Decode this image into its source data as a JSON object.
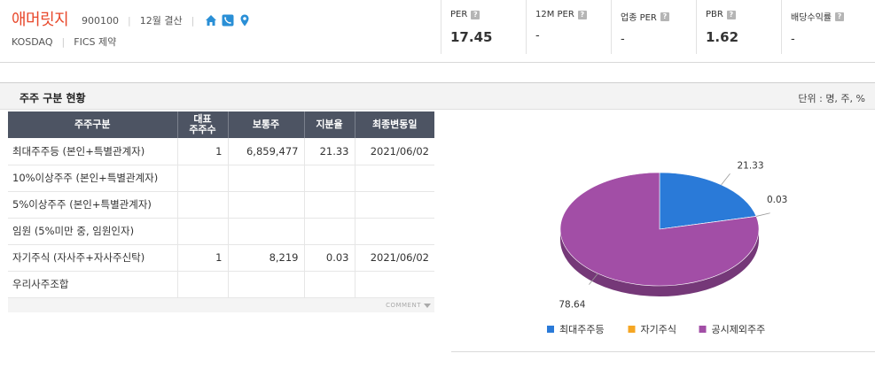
{
  "company": {
    "name": "애머릿지",
    "code": "900100",
    "settlement": "12월 결산",
    "market": "KOSDAQ",
    "sector": "FICS 제약",
    "icons": [
      "home-icon",
      "phone-icon",
      "map-pin-icon"
    ]
  },
  "metrics": [
    {
      "label": "PER",
      "value": "17.45"
    },
    {
      "label": "12M PER",
      "value": "-"
    },
    {
      "label": "업종 PER",
      "value": "-"
    },
    {
      "label": "PBR",
      "value": "1.62"
    },
    {
      "label": "배당수익률",
      "value": "-"
    }
  ],
  "help_glyph": "?",
  "section": {
    "title": "주주 구분 현황",
    "unit": "단위 : 명, 주, %"
  },
  "table": {
    "headers": [
      "주주구분",
      "대표\n주주수",
      "보통주",
      "지분율",
      "최종변동일"
    ],
    "rows": [
      {
        "category": "최대주주등 (본인+특별관계자)",
        "count": "1",
        "shares": "6,859,477",
        "ratio": "21.33",
        "date": "2021/06/02"
      },
      {
        "category": "10%이상주주 (본인+특별관계자)",
        "count": "",
        "shares": "",
        "ratio": "",
        "date": ""
      },
      {
        "category": "5%이상주주 (본인+특별관계자)",
        "count": "",
        "shares": "",
        "ratio": "",
        "date": ""
      },
      {
        "category": "임원 (5%미만 중, 임원인자)",
        "count": "",
        "shares": "",
        "ratio": "",
        "date": ""
      },
      {
        "category": "자기주식 (자사주+자사주신탁)",
        "count": "1",
        "shares": "8,219",
        "ratio": "0.03",
        "date": "2021/06/02"
      },
      {
        "category": "우리사주조합",
        "count": "",
        "shares": "",
        "ratio": "",
        "date": ""
      }
    ],
    "comment_label": "COMMENT"
  },
  "colors": {
    "brand": "#e8482b",
    "header_bg": "#4d5463",
    "icon_blue": "#2a8fd6",
    "series": [
      "#2a7ad8",
      "#f5a623",
      "#a24ea6"
    ]
  },
  "chart_data": {
    "type": "pie",
    "style": "3d",
    "series": [
      {
        "name": "최대주주등",
        "value": 21.33,
        "color": "#2a7ad8"
      },
      {
        "name": "자기주식",
        "value": 0.03,
        "color": "#f5a623"
      },
      {
        "name": "공시제외주주",
        "value": 78.64,
        "color": "#a24ea6"
      }
    ],
    "data_labels": [
      "21.33",
      "0.03",
      "78.64"
    ],
    "legend_position": "bottom"
  }
}
